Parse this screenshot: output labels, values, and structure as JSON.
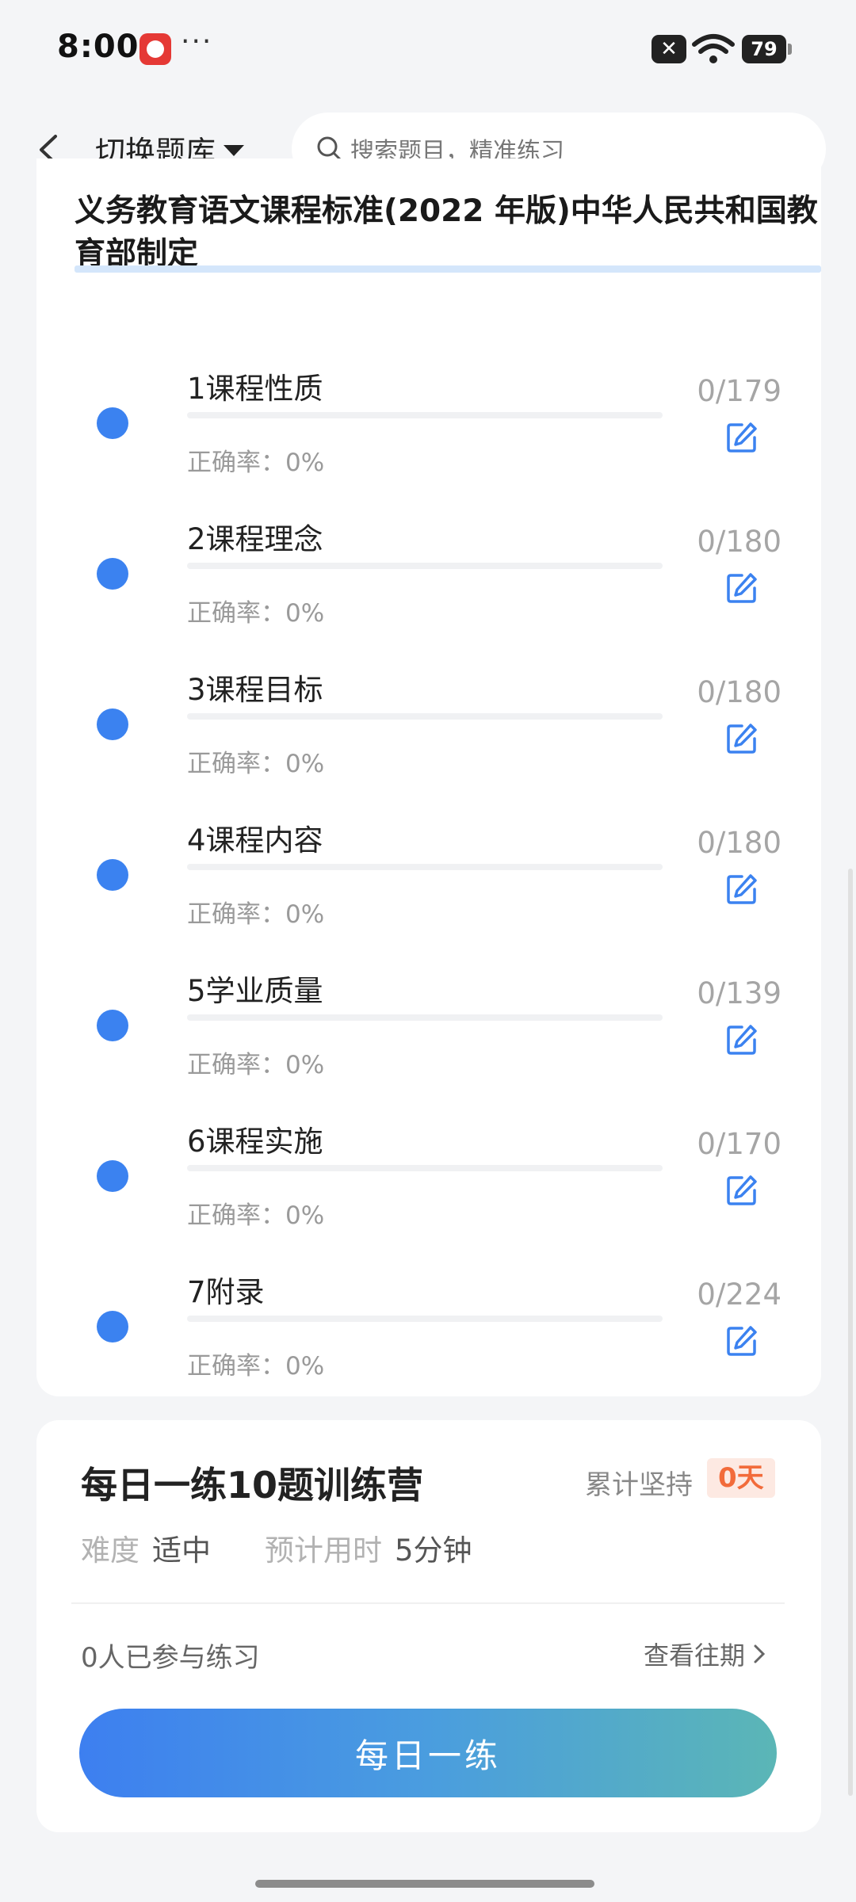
{
  "status_bar": {
    "time": "8:00",
    "more": "···",
    "battery": "79",
    "icons": [
      "app-icon",
      "notification-x-icon",
      "wifi-icon",
      "battery-icon"
    ]
  },
  "header": {
    "back_icon": "chevron-left-icon",
    "bank_switch_label": "切换题库",
    "search_placeholder": "搜索题目，精准练习"
  },
  "book": {
    "title": "义务教育语文课程标准(2022 年版)中华人民共和国教育部制定"
  },
  "chapters": [
    {
      "name": "1课程性质",
      "accuracy": "正确率：0%",
      "count": "0/179",
      "progress": 0
    },
    {
      "name": "2课程理念",
      "accuracy": "正确率：0%",
      "count": "0/180",
      "progress": 0
    },
    {
      "name": "3课程目标",
      "accuracy": "正确率：0%",
      "count": "0/180",
      "progress": 0
    },
    {
      "name": "4课程内容",
      "accuracy": "正确率：0%",
      "count": "0/180",
      "progress": 0
    },
    {
      "name": "5学业质量",
      "accuracy": "正确率：0%",
      "count": "0/139",
      "progress": 0
    },
    {
      "name": "6课程实施",
      "accuracy": "正确率：0%",
      "count": "0/170",
      "progress": 0
    },
    {
      "name": "7附录",
      "accuracy": "正确率：0%",
      "count": "0/224",
      "progress": 0
    }
  ],
  "daily": {
    "title": "每日一练10题训练营",
    "streak_label": "累计坚持",
    "streak_value": "0天",
    "difficulty_label": "难度",
    "difficulty_value": "适中",
    "time_label": "预计用时",
    "time_value": "5分钟",
    "participants": "0人已参与练习",
    "history_link": "查看往期",
    "button_label": "每日一练"
  },
  "colors": {
    "accent": "#3b82f0",
    "streak": "#f26b3a",
    "button_gradient_start": "#3d7ff0",
    "button_gradient_end": "#5bb6b6"
  }
}
